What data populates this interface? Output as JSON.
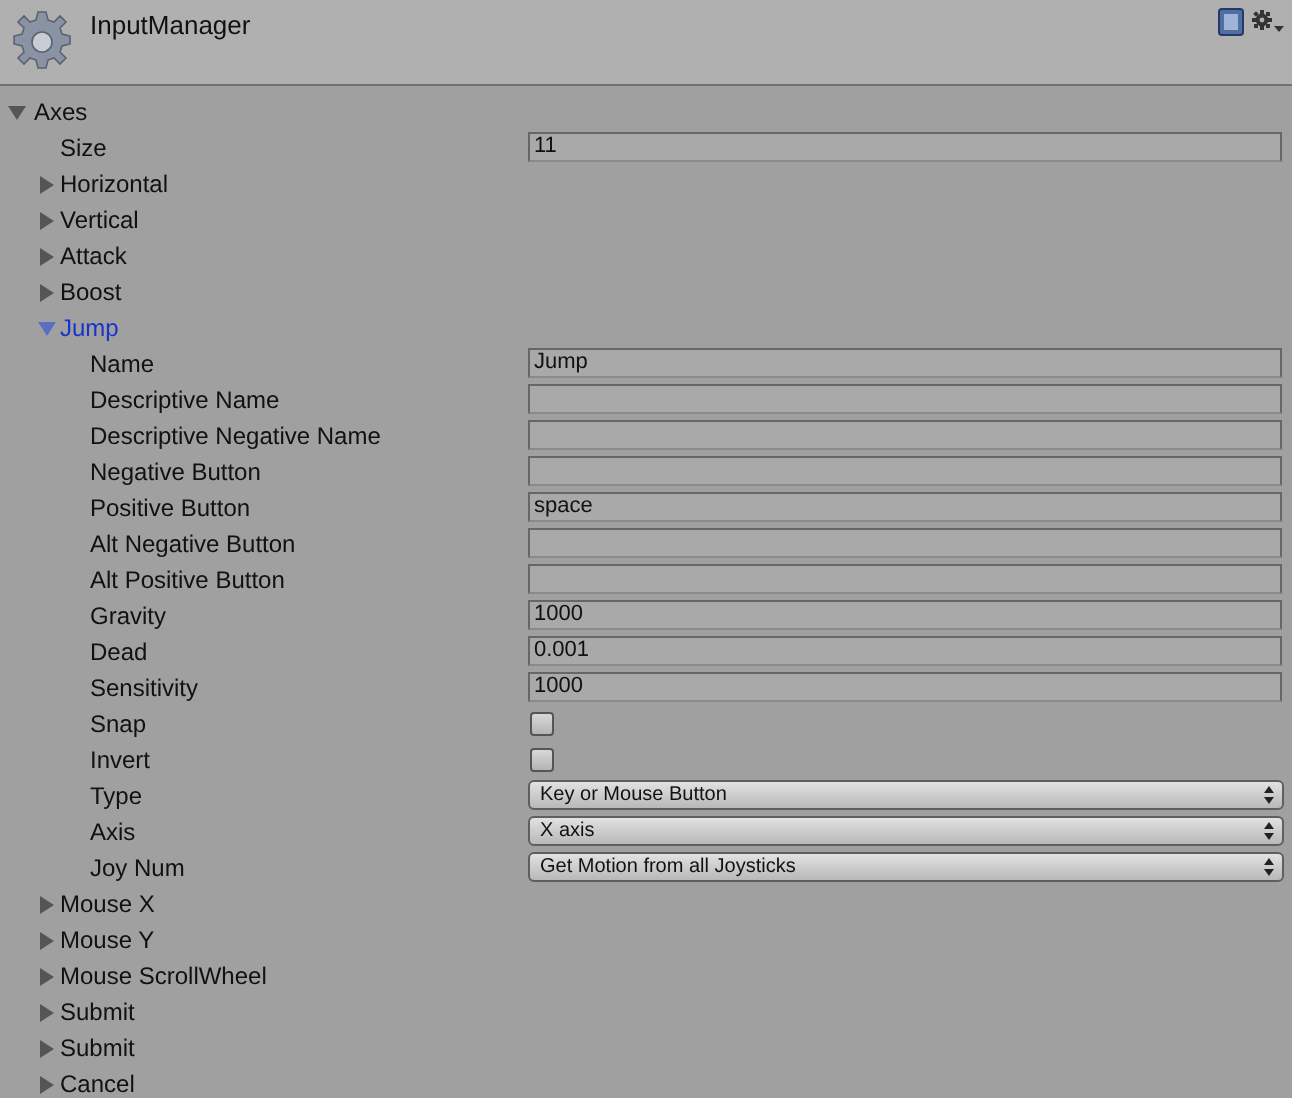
{
  "header": {
    "title": "InputManager"
  },
  "axes": {
    "label": "Axes",
    "expanded": true,
    "size": {
      "label": "Size",
      "value": "11"
    },
    "children": [
      {
        "label": "Horizontal",
        "expanded": false,
        "selected": false
      },
      {
        "label": "Vertical",
        "expanded": false,
        "selected": false
      },
      {
        "label": "Attack",
        "expanded": false,
        "selected": false
      },
      {
        "label": "Boost",
        "expanded": false,
        "selected": false
      },
      {
        "label": "Jump",
        "expanded": true,
        "selected": true,
        "properties": [
          {
            "kind": "text",
            "label": "Name",
            "value": "Jump"
          },
          {
            "kind": "text",
            "label": "Descriptive Name"
          },
          {
            "kind": "text",
            "label": "Descriptive Negative Name"
          },
          {
            "kind": "text",
            "label": "Negative Button"
          },
          {
            "kind": "text",
            "label": "Positive Button",
            "value": "space"
          },
          {
            "kind": "text",
            "label": "Alt Negative Button"
          },
          {
            "kind": "text",
            "label": "Alt Positive Button"
          },
          {
            "kind": "text",
            "label": "Gravity",
            "value": "1000"
          },
          {
            "kind": "text",
            "label": "Dead",
            "value": "0.001"
          },
          {
            "kind": "text",
            "label": "Sensitivity",
            "value": "1000"
          },
          {
            "kind": "checkbox",
            "label": "Snap",
            "checked": false
          },
          {
            "kind": "checkbox",
            "label": "Invert",
            "checked": false
          },
          {
            "kind": "dropdown",
            "label": "Type",
            "value": "Key or Mouse Button"
          },
          {
            "kind": "dropdown",
            "label": "Axis",
            "value": "X axis"
          },
          {
            "kind": "dropdown",
            "label": "Joy Num",
            "value": "Get Motion from all Joysticks"
          }
        ]
      },
      {
        "label": "Mouse X",
        "expanded": false,
        "selected": false
      },
      {
        "label": "Mouse Y",
        "expanded": false,
        "selected": false
      },
      {
        "label": "Mouse ScrollWheel",
        "expanded": false,
        "selected": false
      },
      {
        "label": "Submit",
        "expanded": false,
        "selected": false
      },
      {
        "label": "Submit",
        "expanded": false,
        "selected": false
      },
      {
        "label": "Cancel",
        "expanded": false,
        "selected": false
      }
    ]
  }
}
